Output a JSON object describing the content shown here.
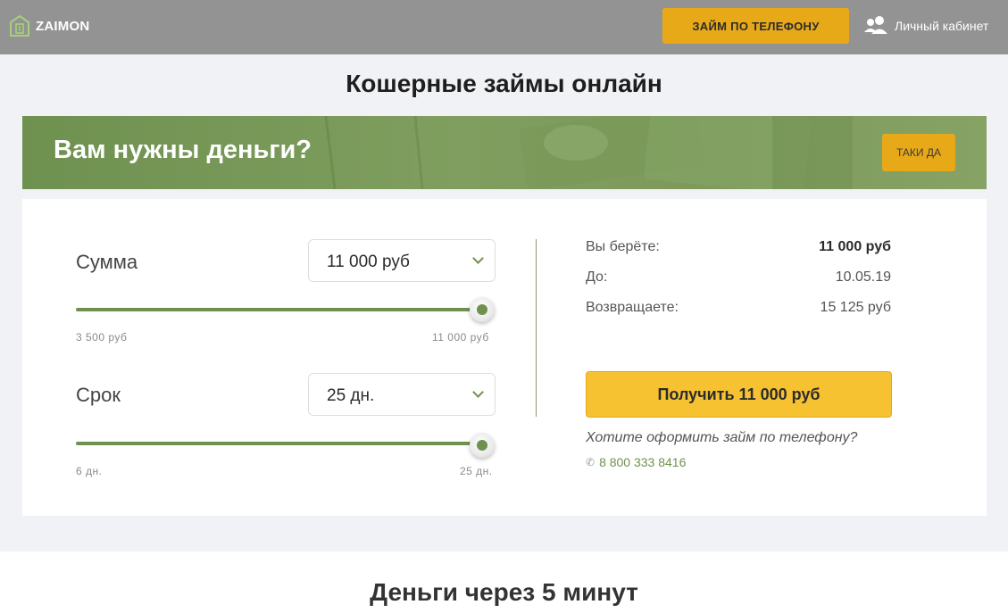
{
  "header": {
    "logo_text": "ZAIMON",
    "phone_loan_button": "ЗАЙМ ПО ТЕЛЕФОНУ",
    "cabinet_label": "Личный кабинет"
  },
  "page_title": "Кошерные займы онлайн",
  "banner": {
    "text": "Вам нужны деньги?",
    "button": "ТАКИ ДА"
  },
  "calculator": {
    "amount": {
      "label": "Сумма",
      "selected": "11 000 руб",
      "min_label": "3 500 руб",
      "max_label": "11 000 руб",
      "level": 1.0
    },
    "term": {
      "label": "Срок",
      "selected": "25 дн.",
      "min_label": "6 дн.",
      "max_label": "25 дн.",
      "level": 1.0
    },
    "summary": {
      "take_label": "Вы берёте:",
      "take_value": "11 000 руб",
      "until_label": "До:",
      "until_value": "10.05.19",
      "return_label": "Возвращаете:",
      "return_value": "15 125 руб"
    },
    "get_button": "Получить 11 000 руб",
    "phone_question": "Хотите оформить займ по телефону?",
    "phone_number": "8 800 333 8416"
  },
  "bottom": {
    "title": "Деньги через 5 минут"
  },
  "colors": {
    "accent_green": "#6f9150",
    "accent_yellow": "#e8a919",
    "header_bg": "#939393"
  }
}
